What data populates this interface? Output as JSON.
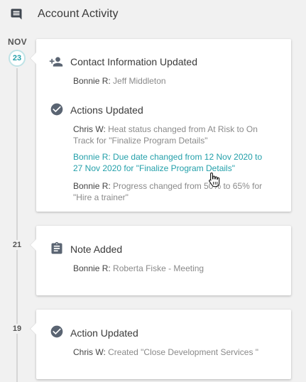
{
  "header": {
    "title": "Account Activity",
    "icon": "comment-icon"
  },
  "timeline": {
    "month": "NOV",
    "days": [
      "23",
      "21",
      "19"
    ]
  },
  "cards": [
    {
      "sections": [
        {
          "icon": "person-add-icon",
          "title": "Contact Information Updated",
          "entries": [
            {
              "who": "Bonnie R:",
              "text": "Jeff Middleton"
            }
          ]
        },
        {
          "icon": "check-circle-icon",
          "title": "Actions Updated",
          "entries": [
            {
              "who": "Chris W:",
              "text": "Heat status changed from At Risk to On Track for \"Finalize Program Details\""
            },
            {
              "who": "Bonnie R:",
              "text": "Due date changed from 12 Nov 2020 to 27 Nov 2020 for \"Finalize Program Details\""
            },
            {
              "who": "Bonnie R:",
              "text": "Progress changed from 50% to 65% for \"Hire a trainer\""
            }
          ]
        }
      ]
    },
    {
      "sections": [
        {
          "icon": "clipboard-icon",
          "title": "Note Added",
          "entries": [
            {
              "who": "Bonnie R:",
              "text": "Roberta Fiske - Meeting"
            }
          ]
        }
      ]
    },
    {
      "sections": [
        {
          "icon": "check-circle-icon",
          "title": "Action Updated",
          "entries": [
            {
              "who": "Chris W:",
              "text": "Created \"Close Development Services \""
            }
          ]
        }
      ]
    }
  ],
  "colors": {
    "accent": "#24a0aa",
    "icon": "#5a6472",
    "background": "#f1f1f1"
  }
}
